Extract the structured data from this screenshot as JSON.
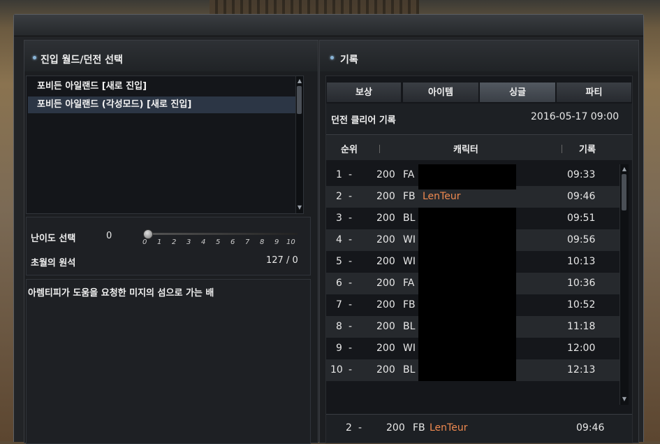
{
  "left": {
    "world_select_title": "진입 월드/던전 선택",
    "dungeons": [
      {
        "label": "포비든 아일랜드 [새로 진입]",
        "selected": false
      },
      {
        "label": "포비든 아일랜드 (각성모드) [새로 진입]",
        "selected": true
      }
    ],
    "difficulty_label": "난이도 선택",
    "difficulty_value": "0",
    "difficulty_ticks": [
      "0",
      "1",
      "2",
      "3",
      "4",
      "5",
      "6",
      "7",
      "8",
      "9",
      "10"
    ],
    "chogwol_label": "초월의 원석",
    "chogwol_value": "127 / 0",
    "description": "아렘티피가 도움을 요청한 미지의 섬으로 가는 배"
  },
  "right": {
    "records_title": "기록",
    "tabs": [
      {
        "label": "보상",
        "active": false
      },
      {
        "label": "아이템",
        "active": false
      },
      {
        "label": "싱글",
        "active": true
      },
      {
        "label": "파티",
        "active": false
      }
    ],
    "clear_record_label": "던전 클리어 기록",
    "clear_record_date": "2016-05-17 09:00",
    "columns": {
      "rank": "순위",
      "character": "캐릭터",
      "record": "기록"
    },
    "rows": [
      {
        "rank": "1",
        "dash": "-",
        "level": "200",
        "cls": "FA",
        "name": "",
        "time": "09:33",
        "highlight": false
      },
      {
        "rank": "2",
        "dash": "-",
        "level": "200",
        "cls": "FB",
        "name": "LenTeur",
        "time": "09:46",
        "highlight": true
      },
      {
        "rank": "3",
        "dash": "-",
        "level": "200",
        "cls": "BL",
        "name": "",
        "time": "09:51",
        "highlight": false
      },
      {
        "rank": "4",
        "dash": "-",
        "level": "200",
        "cls": "WI",
        "name": "",
        "time": "09:56",
        "highlight": false
      },
      {
        "rank": "5",
        "dash": "-",
        "level": "200",
        "cls": "WI",
        "name": "",
        "time": "10:13",
        "highlight": false
      },
      {
        "rank": "6",
        "dash": "-",
        "level": "200",
        "cls": "FA",
        "name": "",
        "time": "10:36",
        "highlight": false
      },
      {
        "rank": "7",
        "dash": "-",
        "level": "200",
        "cls": "FB",
        "name": "",
        "time": "10:52",
        "highlight": false
      },
      {
        "rank": "8",
        "dash": "-",
        "level": "200",
        "cls": "BL",
        "name": "",
        "time": "11:18",
        "highlight": false
      },
      {
        "rank": "9",
        "dash": "-",
        "level": "200",
        "cls": "WI",
        "name": "",
        "time": "12:00",
        "highlight": false
      },
      {
        "rank": "10",
        "dash": "-",
        "level": "200",
        "cls": "BL",
        "name": "",
        "time": "12:13",
        "highlight": false
      }
    ],
    "my_record": {
      "rank": "2",
      "dash": "-",
      "level": "200",
      "cls": "FB",
      "name": "LenTeur",
      "time": "09:46"
    }
  },
  "colors": {
    "highlight_name": "#f08a50",
    "selected_row": "#2c3645"
  }
}
